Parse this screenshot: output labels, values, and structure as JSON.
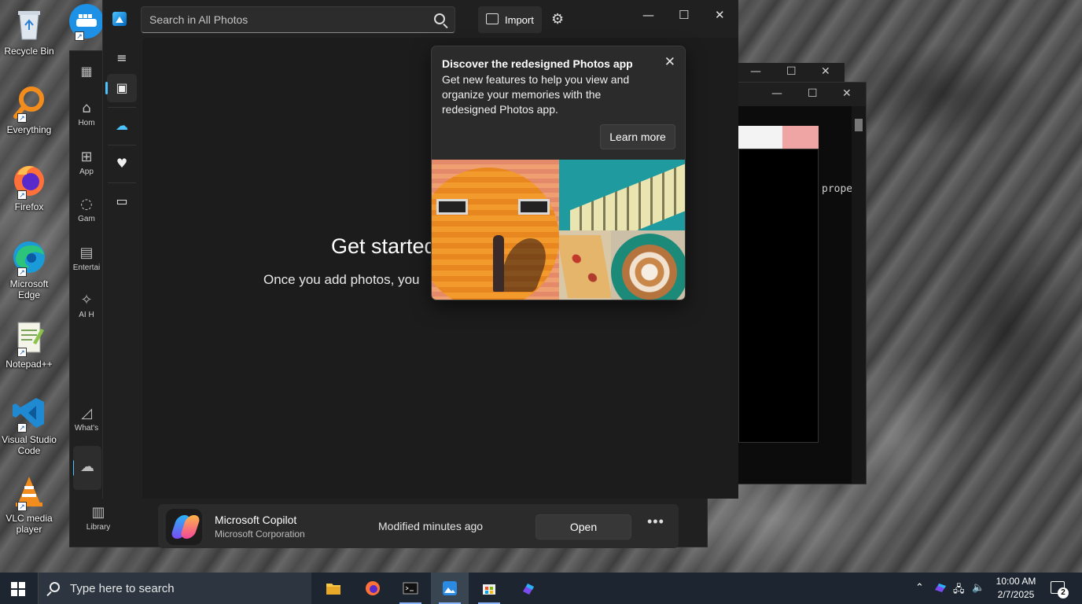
{
  "desktop": {
    "icons": [
      {
        "label": "Recycle Bin"
      },
      {
        "label": "Everything"
      },
      {
        "label": "Firefox"
      },
      {
        "label": "Microsoft Edge"
      },
      {
        "label": "Notepad++"
      },
      {
        "label": "Visual Studio Code"
      },
      {
        "label": "VLC media player"
      }
    ]
  },
  "background_terminal": {
    "text": "prope"
  },
  "store": {
    "nav": [
      {
        "label": "Hom",
        "icon": "home-icon"
      },
      {
        "label": "App",
        "icon": "apps-icon"
      },
      {
        "label": "Gam",
        "icon": "gaming-icon"
      },
      {
        "label": "Entertai",
        "icon": "entertainment-icon"
      },
      {
        "label": "AI H",
        "icon": "ai-hub-icon"
      },
      {
        "label": "What's",
        "icon": "whats-new-icon"
      },
      {
        "label": "Library",
        "icon": "library-icon"
      }
    ],
    "card": {
      "title": "Microsoft Copilot",
      "publisher": "Microsoft Corporation",
      "modified": "Modified minutes ago",
      "open_label": "Open",
      "more_label": "•••"
    }
  },
  "photos": {
    "search": {
      "placeholder": "Search in All Photos"
    },
    "import_label": "Import",
    "main": {
      "title": "Get started",
      "subtitle": "Once you add photos, you"
    },
    "popup": {
      "title": "Discover the redesigned Photos app",
      "body": "Get new features to help you view and organize your memories with the redesigned Photos app.",
      "button": "Learn more"
    }
  },
  "taskbar": {
    "search_placeholder": "Type here to search",
    "time": "10:00 AM",
    "date": "2/7/2025",
    "notification_count": "2"
  },
  "colors": {
    "accent": "#4cc2ff",
    "taskbar": "#1d2630",
    "app_bg": "#202020"
  }
}
